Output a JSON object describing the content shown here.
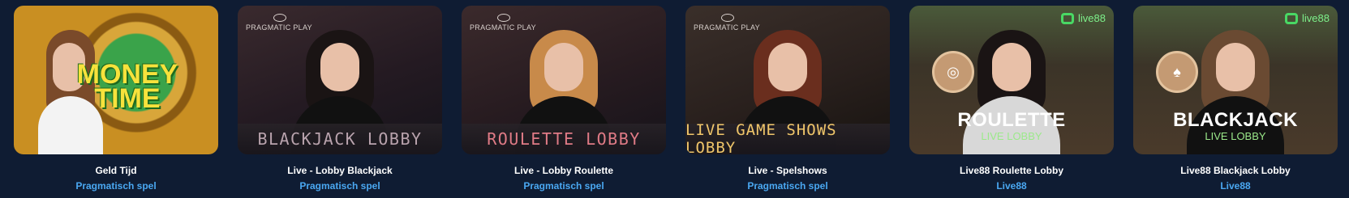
{
  "games": [
    {
      "title": "Geld Tijd",
      "provider": "Pragmatisch spel",
      "thumb_text": "MONEY TIME"
    },
    {
      "title": "Live - Lobby Blackjack",
      "provider": "Pragmatisch spel",
      "logo": "PRAGMATIC PLAY",
      "banner": "BLACKJACK LOBBY",
      "banner_color": "#b9a3ad"
    },
    {
      "title": "Live - Lobby Roulette",
      "provider": "Pragmatisch spel",
      "logo": "PRAGMATIC PLAY",
      "banner": "ROULETTE LOBBY",
      "banner_color": "#e07b86"
    },
    {
      "title": "Live - Spelshows",
      "provider": "Pragmatisch spel",
      "logo": "PRAGMATIC PLAY",
      "banner": "LIVE GAME SHOWS LOBBY",
      "banner_color": "#f0c66a"
    },
    {
      "title": "Live88 Roulette Lobby",
      "provider": "Live88",
      "logo": "live88",
      "big": "ROULETTE",
      "sub": "LIVE LOBBY",
      "badge_icon": "roulette-wheel-icon"
    },
    {
      "title": "Live88 Blackjack Lobby",
      "provider": "Live88",
      "logo": "live88",
      "big": "BLACKJACK",
      "sub": "LIVE LOBBY",
      "badge_icon": "cards-21-icon"
    }
  ],
  "colors": {
    "background": "#0f1c33",
    "provider_link": "#4aa8f2"
  }
}
